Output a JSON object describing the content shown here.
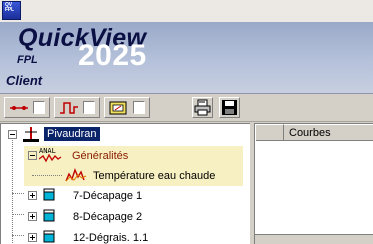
{
  "app": {
    "icon_label": "QV FPL",
    "banner": {
      "title": "QuickView",
      "year": "2025",
      "subtitle": "FPL",
      "role": "Client"
    }
  },
  "toolbar": {
    "toggles": [
      {
        "icon": "signal-dots-icon",
        "checked": false
      },
      {
        "icon": "square-wave-icon",
        "checked": false
      },
      {
        "icon": "analog-meter-icon",
        "checked": false
      }
    ],
    "actions": [
      {
        "icon": "printer-icon"
      },
      {
        "icon": "save-icon"
      }
    ]
  },
  "tree": {
    "root": {
      "label": "Pivaudran",
      "expanded": true,
      "selected": true
    },
    "group": {
      "label": "Généralités",
      "expanded": true,
      "icon_label": "ANAL"
    },
    "group_item": {
      "label": "Température eau chaude"
    },
    "nodes": [
      {
        "label": "7-Décapage 1",
        "expanded": false
      },
      {
        "label": "8-Décapage 2",
        "expanded": false
      },
      {
        "label": "12-Dégrais. 1.1",
        "expanded": false
      }
    ]
  },
  "grid": {
    "columns": [
      "Courbes"
    ]
  },
  "colors": {
    "selection": "#0a246a",
    "highlight": "#f7f0c2",
    "banner": "#b5c1da",
    "tank": "#00b4d8"
  }
}
